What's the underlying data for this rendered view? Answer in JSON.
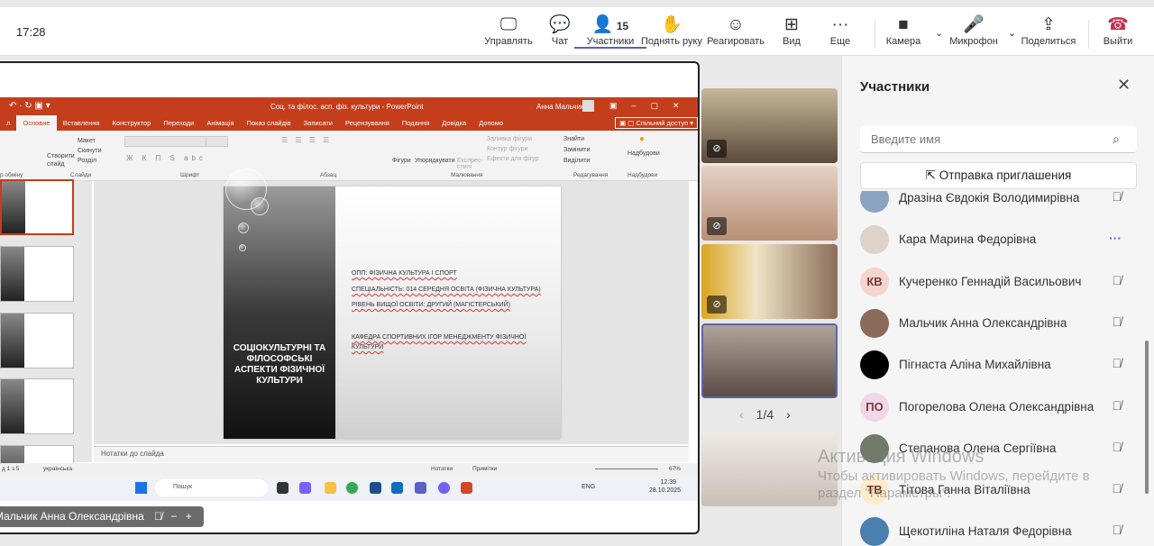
{
  "meeting": {
    "time": "17:28"
  },
  "toolbar": [
    {
      "id": "manage",
      "label": "Управлять",
      "icon": "screen-cursor-icon"
    },
    {
      "id": "chat",
      "label": "Чат",
      "icon": "chat-icon"
    },
    {
      "id": "participants",
      "label": "Участники",
      "icon": "people-icon",
      "count": "15",
      "active": true
    },
    {
      "id": "raise-hand",
      "label": "Поднять руку",
      "icon": "hand-icon"
    },
    {
      "id": "react",
      "label": "Реагировать",
      "icon": "smile-icon"
    },
    {
      "id": "view",
      "label": "Вид",
      "icon": "grid-icon"
    },
    {
      "id": "more",
      "label": "Еще",
      "icon": "more-icon"
    },
    {
      "id": "camera",
      "label": "Камера",
      "icon": "camera-icon"
    },
    {
      "id": "mic",
      "label": "Микрофон",
      "icon": "mic-icon"
    },
    {
      "id": "share",
      "label": "Поделиться",
      "icon": "share-icon"
    },
    {
      "id": "leave",
      "label": "Выйти",
      "icon": "phone-hangup-icon",
      "color": "#c4314b"
    }
  ],
  "ppt": {
    "title": "Соц. та філос. асп. фіз. культури  -  PowerPoint",
    "user": "Анна Мальчик",
    "tabs": [
      "Основне",
      "Вставлення",
      "Конструктор",
      "Переходи",
      "Анімація",
      "Показ слайдів",
      "Записати",
      "Рецензування",
      "Подання",
      "Довідка",
      "Допомо"
    ],
    "share": "Спільний доступ",
    "ribbon_groups": [
      "р обміну",
      "Слайди",
      "Шрифт",
      "Абзац",
      "Малювання",
      "Редагування",
      "Надбудови"
    ],
    "ribbon_items": [
      "Макет",
      "Скинути",
      "Розділ",
      "Створити слайд",
      "Фігури",
      "Упорядкувати",
      "Експрес-стилі",
      "Заливка фігури",
      "Контур фігури",
      "Ефекти для фігур",
      "Знайти",
      "Замінити",
      "Виділити",
      "Надбудови"
    ],
    "slide": {
      "title": "СОЦІОКУЛЬТУРНІ ТА ФІЛОСОФСЬКІ АСПЕКТИ ФІЗИЧНОЇ КУЛЬТУРИ",
      "lines": [
        "ОПП: ФІЗИЧНА КУЛЬТУРА І СПОРТ",
        "СПЕЦІАЛЬНІСТЬ: 014 СЕРЕДНЯ ОСВІТА (ФІЗИЧНА КУЛЬТУРА)",
        "РІВЕНЬ ВИЩОЇ ОСВІТИ: ДРУГИЙ (МАГІСТЕРСЬКИЙ)",
        "КАФЕДРА СПОРТИВНИХ ІГОР МЕНЕДЖМЕНТУ ФІЗИЧНОЇ КУЛЬТУРИ"
      ]
    },
    "notes": "Нотатки до слайда",
    "status": {
      "slide": "д 1 з 5",
      "lang": "українська",
      "notes_btn": "Нотатки",
      "comments_btn": "Примітки",
      "zoom": "67%"
    },
    "taskbar": {
      "search": "Пошук",
      "lang": "ENG",
      "time": "12:39",
      "date": "28.10.2025"
    }
  },
  "presenter": {
    "name": "Мальчик Анна Олександрівна"
  },
  "gallery": {
    "page": "1/4"
  },
  "panel": {
    "title": "Участники",
    "search_placeholder": "Введите имя",
    "invite": "Отправка приглашения",
    "participants": [
      {
        "name": "Дразіна Євдокія Володимирівна",
        "avatar": "photo",
        "status": "muted"
      },
      {
        "name": "Кара Марина Федорівна",
        "avatar": "photo",
        "status": "more"
      },
      {
        "name": "Кучеренко Геннадій Васильович",
        "initials": "КВ",
        "avatar": "initials",
        "color": "#f6d5cf",
        "status": "muted"
      },
      {
        "name": "Мальчик Анна Олександрівна",
        "avatar": "photo",
        "status": "muted"
      },
      {
        "name": "Пігнаста Аліна Михайлівна",
        "avatar": "black",
        "status": "muted"
      },
      {
        "name": "Погорелова Олена Олександрівна",
        "initials": "ПО",
        "avatar": "initials",
        "color": "#f1d7e8",
        "status": "muted"
      },
      {
        "name": "Степанова Олена Сергіївна",
        "avatar": "photo",
        "status": "muted"
      },
      {
        "name": "Тітова Ганна Віталіївна",
        "initials": "ТВ",
        "avatar": "initials",
        "color": "#fbeccb",
        "status": "muted"
      },
      {
        "name": "Щекотиліна Наталя Федорівна",
        "avatar": "photo",
        "status": "muted"
      }
    ]
  },
  "watermark": {
    "title": "Активация Windows",
    "text": "Чтобы активировать Windows, перейдите в раздел \"Параметры\"."
  }
}
